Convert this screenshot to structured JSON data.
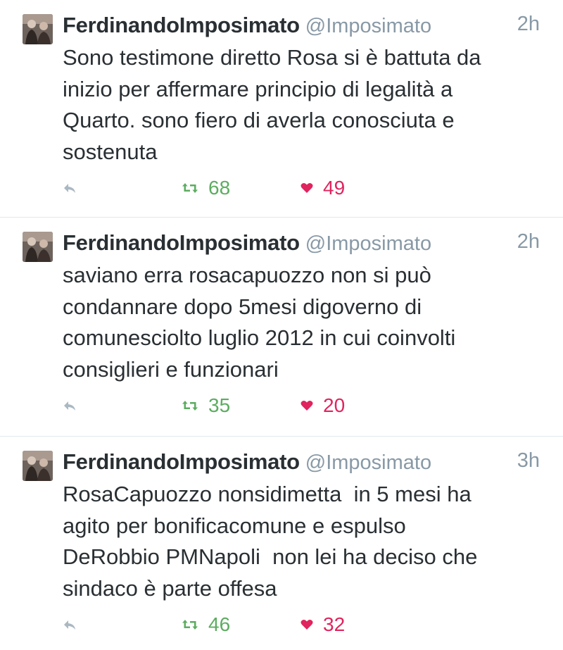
{
  "colors": {
    "text": "#292f33",
    "secondary": "#8899a6",
    "retweet": "#5cac60",
    "like": "#e0245e",
    "divider": "#e1e8ed"
  },
  "icons": {
    "reply": "reply-arrow-icon",
    "retweet": "retweet-icon",
    "like": "heart-icon"
  },
  "tweets": [
    {
      "display_name": "FerdinandoImposimato",
      "handle": "@Imposimato",
      "time": "2h",
      "text": "Sono testimone diretto Rosa si è battuta da\ninizio per affermare principio di legalità a\nQuarto. sono fiero di averla conosciuta e\nsostenuta",
      "retweets": "68",
      "likes": "49"
    },
    {
      "display_name": "FerdinandoImposimato",
      "handle": "@Imposimato",
      "time": "2h",
      "text": "saviano erra rosacapuozzo non si può\ncondannare dopo 5mesi digoverno di\ncomunesciolto luglio 2012 in cui coinvolti\nconsiglieri e funzionari",
      "retweets": "35",
      "likes": "20"
    },
    {
      "display_name": "FerdinandoImposimato",
      "handle": "@Imposimato",
      "time": "3h",
      "text": "RosaCapuozzo nonsidimetta  in 5 mesi ha\nagito per bonificacomune e espulso\nDeRobbio PMNapoli  non lei ha deciso che\nsindaco è parte offesa",
      "retweets": "46",
      "likes": "32"
    }
  ]
}
